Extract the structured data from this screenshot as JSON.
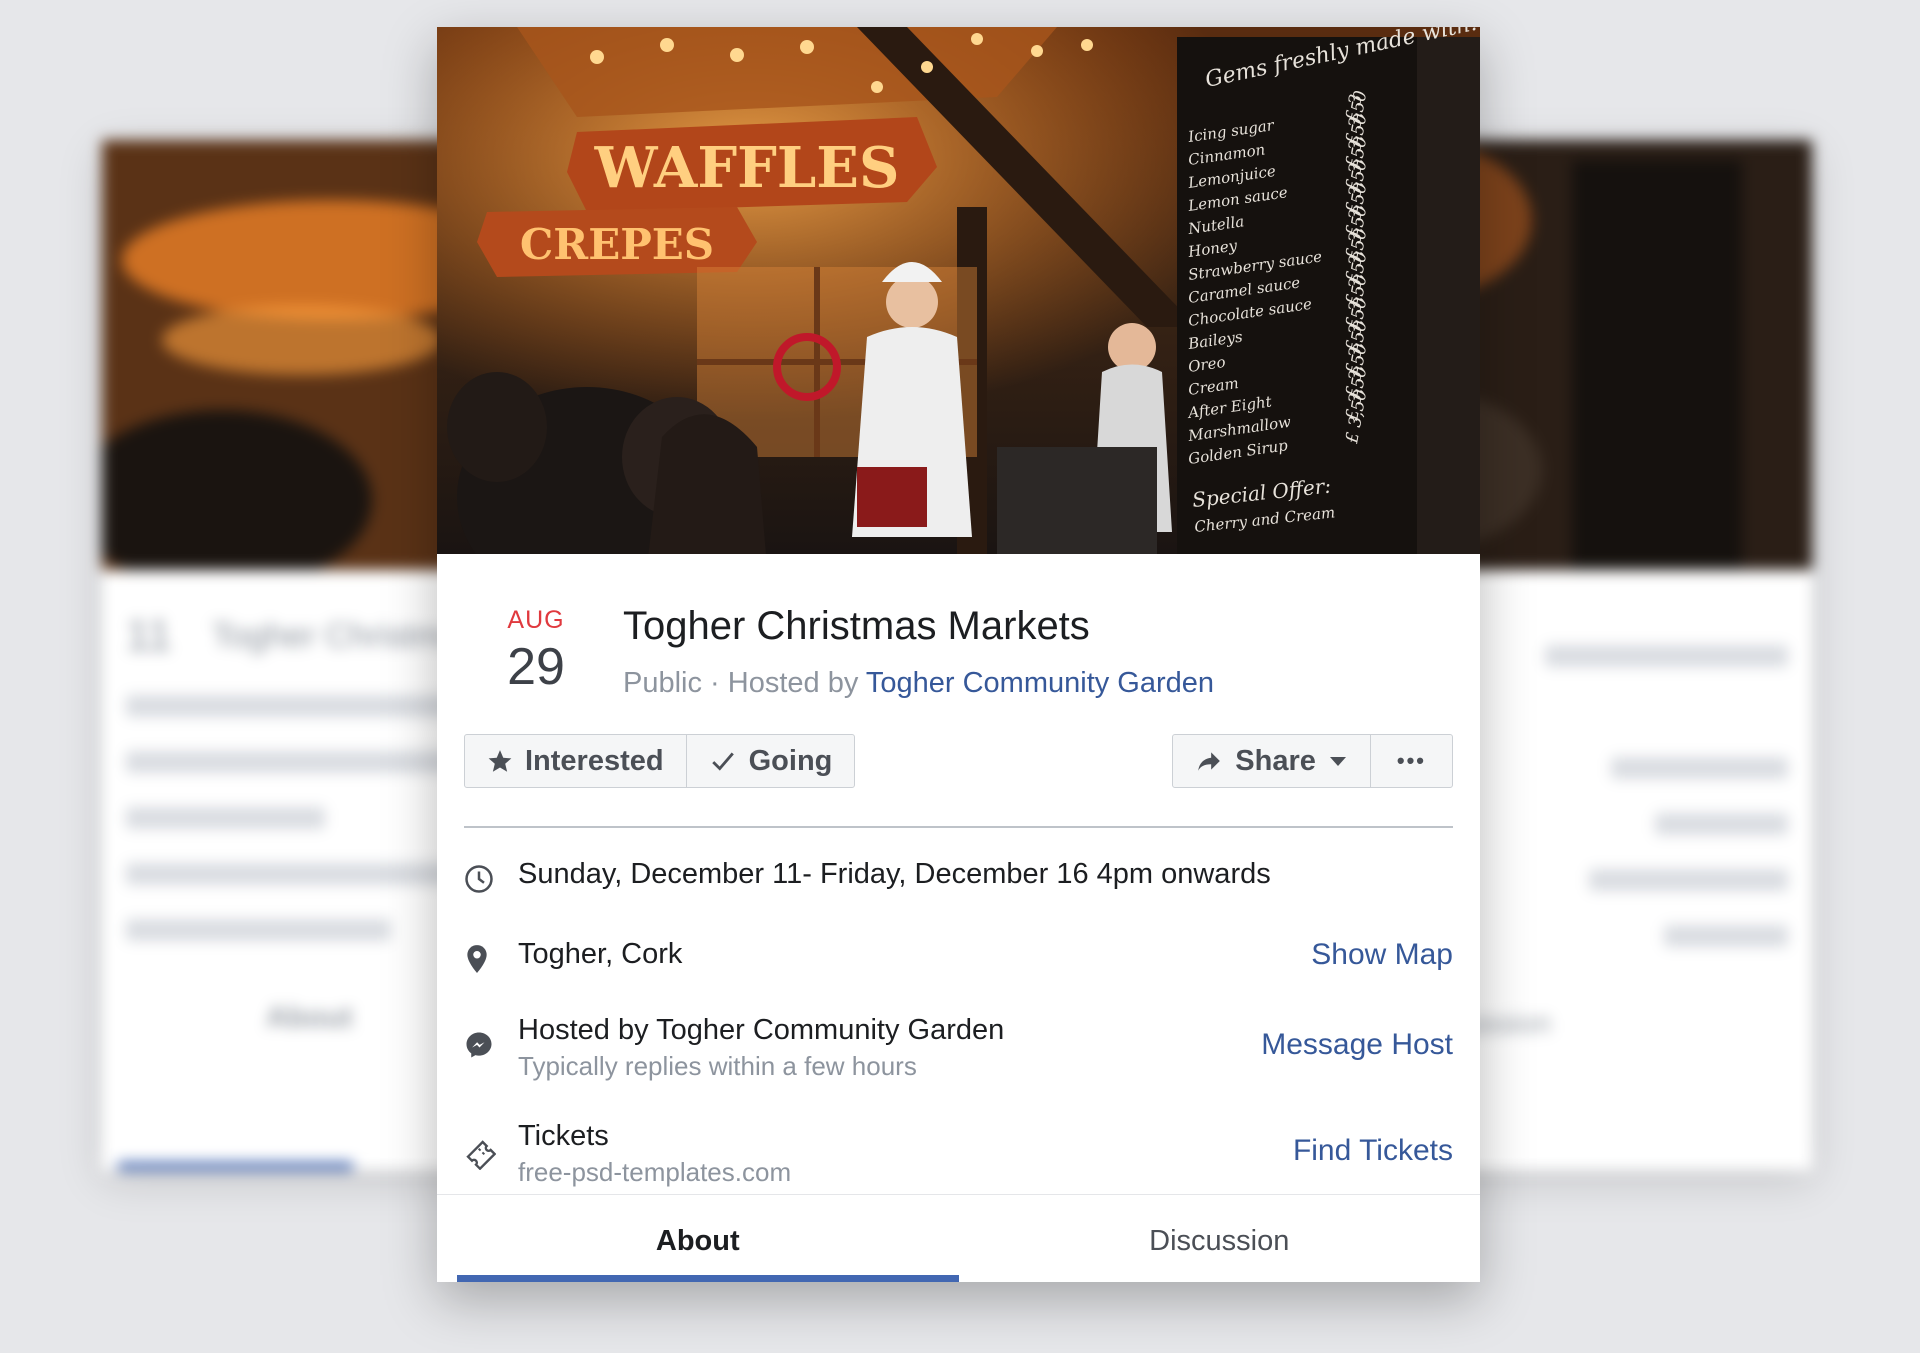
{
  "event": {
    "month": "AUG",
    "day": "29",
    "title": "Togher Christmas Markets",
    "visibility": "Public · Hosted by",
    "host": "Togher Community Garden"
  },
  "actions": {
    "interested": "Interested",
    "going": "Going",
    "share": "Share",
    "more": "•••"
  },
  "details": {
    "datetime": "Sunday, December 11- Friday, December 16 4pm onwards",
    "location": "Togher, Cork",
    "show_map": "Show Map",
    "hosted_by": "Hosted by Togher Community Garden",
    "reply_time": "Typically replies within a few hours",
    "message_host": "Message Host",
    "tickets": "Tickets",
    "tickets_site": "free-psd-templates.com",
    "find_tickets": "Find Tickets"
  },
  "tabs": {
    "about": "About",
    "discussion": "Discussion"
  },
  "cover_signs": {
    "waffles": "WAFFLES",
    "crepes": "CREPES",
    "menu_header": "Gems freshly made with:",
    "menu_items": [
      "Icing sugar",
      "Cinnamon",
      "Lemonjuice",
      "Lemon sauce",
      "Nutella",
      "Honey",
      "Strawberry sauce",
      "Caramel sauce",
      "Chocolate sauce",
      "Baileys",
      "Oreo",
      "Cream",
      "After Eight",
      "Marshmallow",
      "Golden Sirup"
    ],
    "menu_prices": [
      "£ 3",
      "£ 3,50",
      "£ 3,50",
      "£ 3,50",
      "£ 3,50",
      "£ 3,50",
      "£ 3,50",
      "£ 3,50",
      "£ 3,50",
      "£ 3,50",
      "£ 3,50",
      "£ 3,50",
      "£ 3,50",
      "£ 3,50",
      "£ 3,50"
    ],
    "special_offer": "Special Offer:",
    "special_item": "Cherry and Cream",
    "bg_day": "11",
    "bg_title": "Togher Christmas",
    "bg_about": "About",
    "bg_discussion": "Discussion"
  },
  "colors": {
    "accent": "#4267b2",
    "link": "#365899",
    "month": "#e0393e"
  }
}
